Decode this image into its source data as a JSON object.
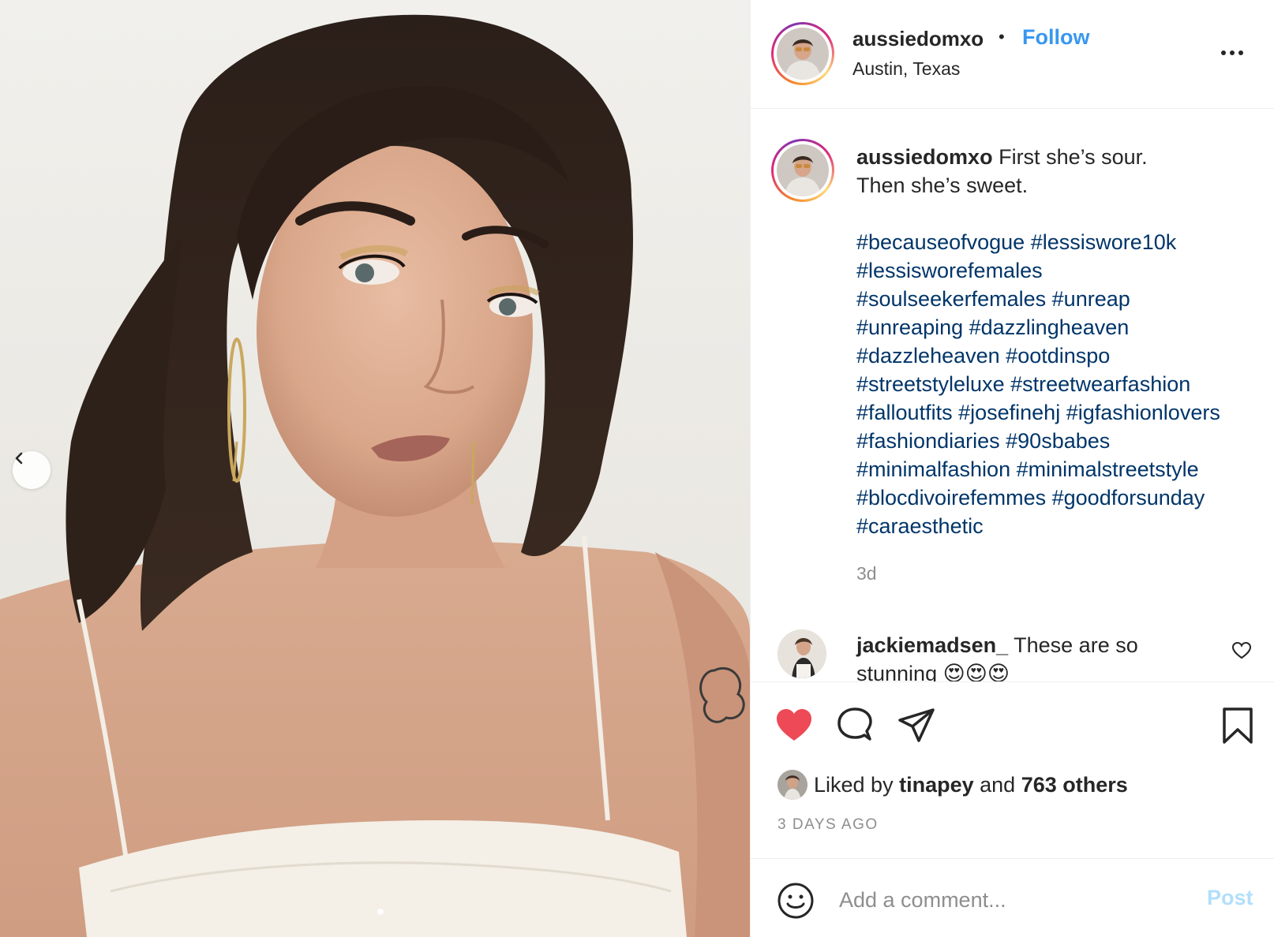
{
  "post": {
    "username": "aussiedomxo",
    "follow_label": "Follow",
    "separator": "•",
    "location": "Austin, Texas",
    "more_icon": "more-horizontal-icon"
  },
  "caption": {
    "username": "aussiedomxo",
    "line1": "First she’s sour.",
    "line2": "Then she’s sweet.",
    "hashtags": [
      "#becauseofvogue",
      "#lessiswore10k",
      "#lessisworefemales",
      "#soulseekerfemales",
      "#unreap",
      "#unreaping",
      "#dazzlingheaven",
      "#dazzleheaven",
      "#ootdinspo",
      "#streetstyleluxe",
      "#streetwearfashion",
      "#falloutfits",
      "#josefinehj",
      "#igfashionlovers",
      "#fashiondiaries",
      "#90sbabes",
      "#minimalfashion",
      "#minimalstreetstyle",
      "#blocdivoirefemmes",
      "#goodforsunday",
      "#caraesthetic"
    ],
    "time": "3d"
  },
  "comments": [
    {
      "username": "jackiemadsen_",
      "text": "These are so stunning 😍😍😍"
    }
  ],
  "actions": {
    "liked": true,
    "like_color": "#ed4956"
  },
  "likes": {
    "prefix": "Liked by",
    "user": "tinapey",
    "middle": "and",
    "others": "763 others"
  },
  "timestamp": "3 DAYS AGO",
  "add_comment": {
    "placeholder": "Add a comment...",
    "post_label": "Post"
  },
  "colors": {
    "link": "#3897f0",
    "hashtag": "#003569",
    "muted": "#8e8e8e"
  }
}
